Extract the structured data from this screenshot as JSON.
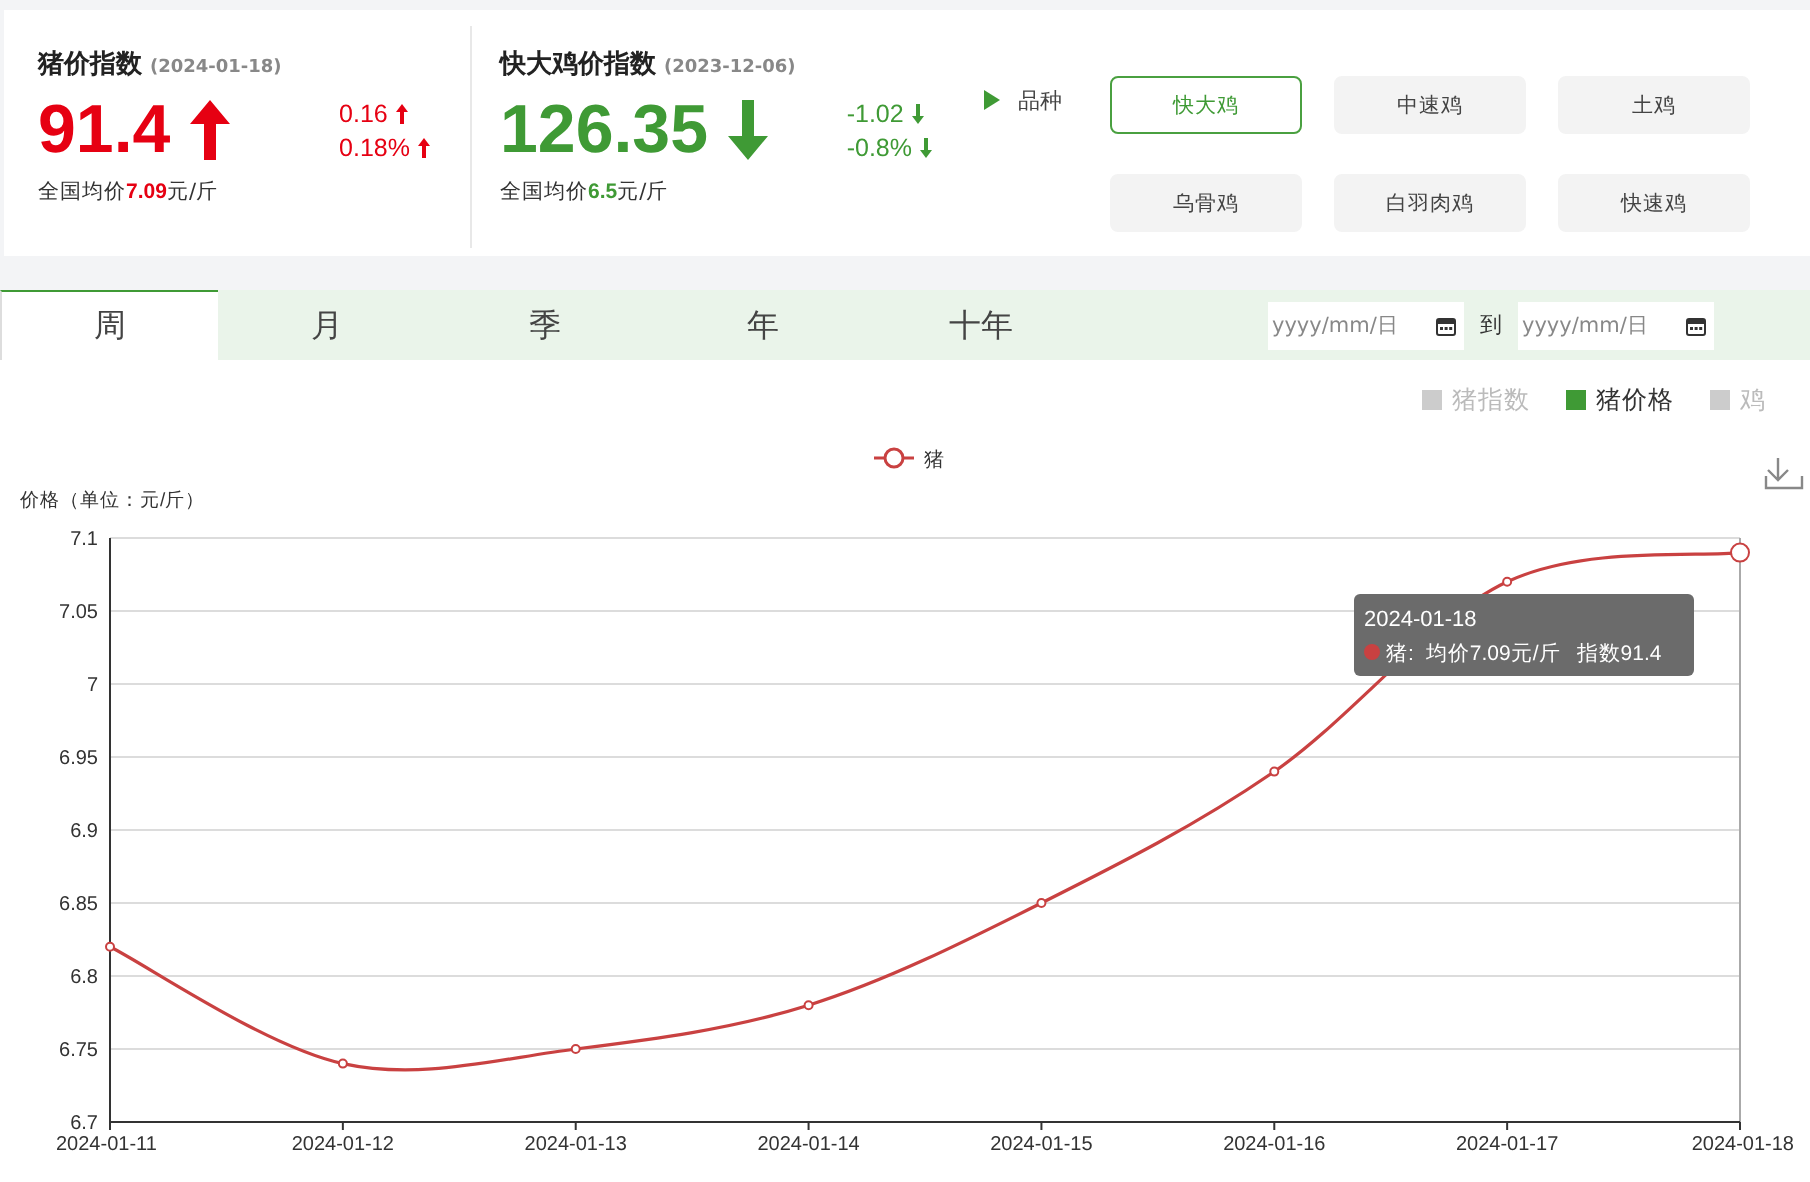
{
  "indices": [
    {
      "title": "猪价指数",
      "date": "(2024-01-18)",
      "value": "91.4",
      "rising": true,
      "changes": [
        {
          "text": "0.16",
          "rising": true
        },
        {
          "text": "0.18%",
          "rising": true
        }
      ],
      "avg_label": "全国均价",
      "avg_value": "7.09",
      "avg_unit": "元/斤"
    },
    {
      "title": "快大鸡价指数",
      "date": "(2023-12-06)",
      "value": "126.35",
      "rising": false,
      "changes": [
        {
          "text": "-1.02",
          "rising": false
        },
        {
          "text": "-0.8%",
          "rising": false
        }
      ],
      "avg_label": "全国均价",
      "avg_value": "6.5",
      "avg_unit": "元/斤"
    }
  ],
  "breed": {
    "label": "品种",
    "options": [
      {
        "label": "快大鸡",
        "selected": true
      },
      {
        "label": "中速鸡",
        "selected": false
      },
      {
        "label": "土鸡",
        "selected": false
      },
      {
        "label": "乌骨鸡",
        "selected": false
      },
      {
        "label": "白羽肉鸡",
        "selected": false
      },
      {
        "label": "快速鸡",
        "selected": false
      }
    ]
  },
  "period_tabs": [
    {
      "label": "周",
      "selected": true
    },
    {
      "label": "月",
      "selected": false
    },
    {
      "label": "季",
      "selected": false
    },
    {
      "label": "年",
      "selected": false
    },
    {
      "label": "十年",
      "selected": false
    }
  ],
  "date_range": {
    "start_placeholder": "yyyy/mm/日",
    "separator": "到",
    "end_placeholder": "yyyy/mm/日"
  },
  "series_toggles": [
    {
      "label": "猪指数",
      "on": false
    },
    {
      "label": "猪价格",
      "on": true
    },
    {
      "label": "鸡",
      "on": false
    }
  ],
  "chart": {
    "chart_data": {
      "type": "line",
      "ylabel": "价格（单位：元/斤）",
      "categories": [
        "2024-01-11",
        "2024-01-12",
        "2024-01-13",
        "2024-01-14",
        "2024-01-15",
        "2024-01-16",
        "2024-01-17",
        "2024-01-18"
      ],
      "grid": true,
      "series": [
        {
          "name": "猪",
          "color": "#c94141",
          "marker": true,
          "values": [
            6.82,
            6.74,
            6.75,
            6.78,
            6.85,
            6.94,
            7.07,
            7.09
          ]
        }
      ],
      "ylim": [
        6.7,
        7.1
      ],
      "yticks": [
        6.7,
        6.75,
        6.8,
        6.85,
        6.9,
        6.95,
        7,
        7.05,
        7.1
      ]
    },
    "tooltip": {
      "date": "2024-01-18",
      "series": "猪:",
      "price": "均价7.09元/斤",
      "index": "指数91.4"
    }
  }
}
